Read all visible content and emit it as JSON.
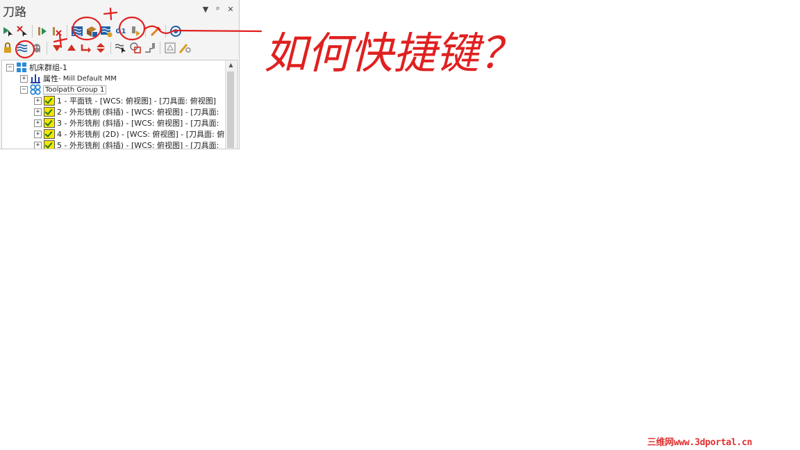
{
  "panel": {
    "title": "刀路",
    "buttons": {
      "dropdown": "▼",
      "pin": "ᵖ",
      "close": "✕"
    },
    "g1_label": "G1"
  },
  "tree": {
    "machine_group": "机床群组-1",
    "properties_label": "属性",
    "properties_detail": " - Mill Default MM",
    "toolpath_group": "Toolpath Group 1",
    "operations": [
      "1 - 平面铣 - [WCS: 俯视图] - [刀具面: 俯视图]",
      "2 - 外形铣削 (斜插) - [WCS: 俯视图] - [刀具面:",
      "3 - 外形铣削 (斜插) - [WCS: 俯视图] - [刀具面:",
      "4 - 外形铣削 (2D) - [WCS: 俯视图] - [刀具面: 俯",
      "5 - 外形铣削 (斜插) - [WCS: 俯视图] - [刀具面:"
    ]
  },
  "annotation": {
    "text": "如何快捷键？",
    "color": "#e02020"
  },
  "watermark": "三维网www.3dportal.cn",
  "colors": {
    "accent_red": "#e02020",
    "icon_blue": "#1f5fa8",
    "icon_green": "#2e8b57",
    "check_yellow": "#f5e400"
  }
}
